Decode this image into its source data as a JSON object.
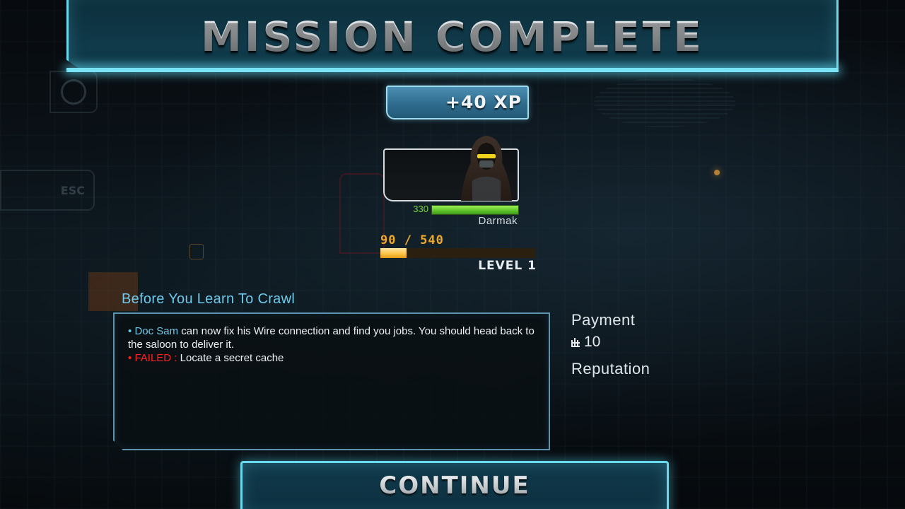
{
  "header": {
    "title": "MISSION COMPLETE"
  },
  "ghost_ui": {
    "esc_label": "ESC"
  },
  "xp_badge": {
    "label": "+40 XP"
  },
  "character": {
    "name": "Darmak",
    "hp_value": "330",
    "hp_fill_fraction": 1.0,
    "xp_progress_text": "90 / 540",
    "xp_current": 90,
    "xp_max": 540,
    "level_text": "LEVEL 1"
  },
  "mission": {
    "title": "Before You Learn To Crawl",
    "objectives": [
      {
        "bullet": "•",
        "highlight": "Doc Sam",
        "text": " can now fix his Wire connection and find you jobs. You should head back to the saloon to deliver it."
      },
      {
        "bullet": "•",
        "highlight": "FAILED :",
        "text": " Locate a secret cache"
      }
    ]
  },
  "rewards": {
    "payment_label": "Payment",
    "payment_icon": "credits-icon",
    "payment_value": "10",
    "reputation_label": "Reputation"
  },
  "continue_button": {
    "label": "CONTINUE"
  },
  "colors": {
    "accent_cyan": "#6ad8ec",
    "mission_title_blue": "#6fc9ea",
    "hp_green": "#7ad63c",
    "xp_orange": "#f0a92c",
    "failed_red": "#ff2222"
  }
}
